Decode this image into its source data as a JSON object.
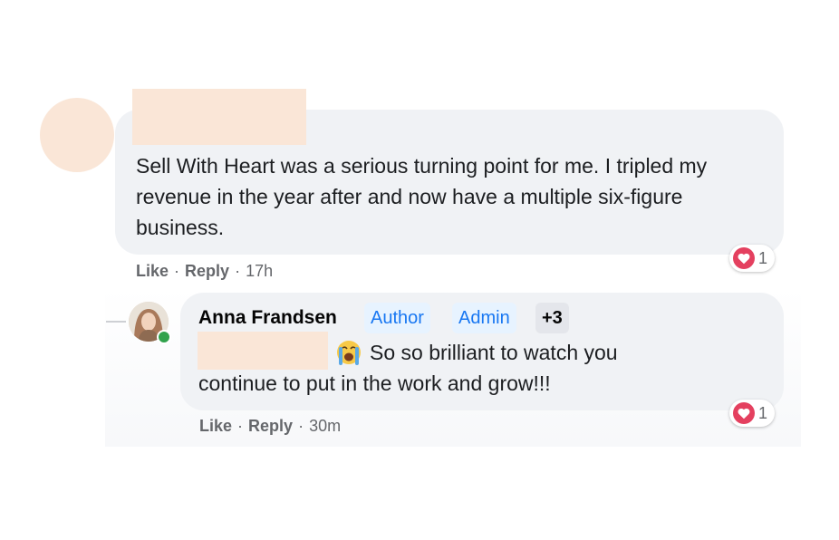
{
  "comment": {
    "text": "Sell With Heart was a serious turning point for me. I tripled my revenue in the year after and now have a multiple six-figure business.",
    "actions": {
      "like": "Like",
      "reply": "Reply",
      "time": "17h"
    },
    "reaction": {
      "icon": "heart-icon",
      "count": "1"
    }
  },
  "reply": {
    "author": "Anna Frandsen",
    "badges": [
      "Author",
      "Admin",
      "+3"
    ],
    "emoji": "crying-face-icon",
    "text_line1": "So so brilliant to watch you",
    "text_line2": "continue to put in the work and grow!!!",
    "actions": {
      "like": "Like",
      "reply": "Reply",
      "time": "30m"
    },
    "reaction": {
      "icon": "heart-icon",
      "count": "1"
    }
  },
  "colors": {
    "bubble": "#f0f2f5",
    "badge_bg": "#e7f3ff",
    "badge_text": "#1877f2",
    "heart": "#e4405f",
    "online": "#31a24c",
    "redaction": "#fae6d7"
  }
}
